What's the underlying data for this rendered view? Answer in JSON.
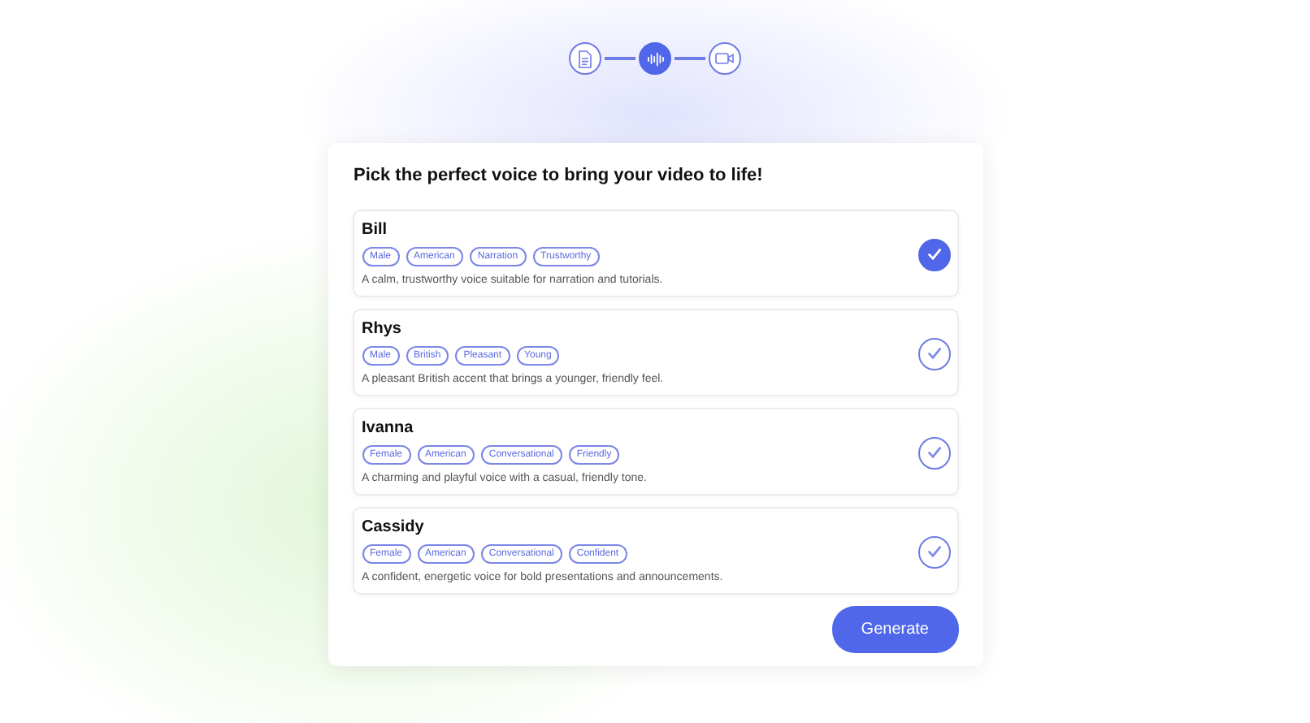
{
  "steps": [
    {
      "kind": "document",
      "selected": false
    },
    {
      "kind": "audio",
      "selected": true
    },
    {
      "kind": "video",
      "selected": false
    }
  ],
  "title": "Pick the perfect voice to bring your video to life!",
  "voices": [
    {
      "name": "Bill",
      "tags": [
        "Male",
        "American",
        "Narration",
        "Trustworthy"
      ],
      "description": "A calm, trustworthy voice suitable for narration and tutorials.",
      "selected": true
    },
    {
      "name": "Rhys",
      "tags": [
        "Male",
        "British",
        "Pleasant",
        "Young"
      ],
      "description": "A pleasant British accent that brings a younger, friendly feel.",
      "selected": false
    },
    {
      "name": "Ivanna",
      "tags": [
        "Female",
        "American",
        "Conversational",
        "Friendly"
      ],
      "description": "A charming and playful voice with a casual, friendly tone.",
      "selected": false
    },
    {
      "name": "Cassidy",
      "tags": [
        "Female",
        "American",
        "Conversational",
        "Confident"
      ],
      "description": "A confident, energetic voice for bold presentations and announcements.",
      "selected": false
    }
  ],
  "button": "Generate"
}
